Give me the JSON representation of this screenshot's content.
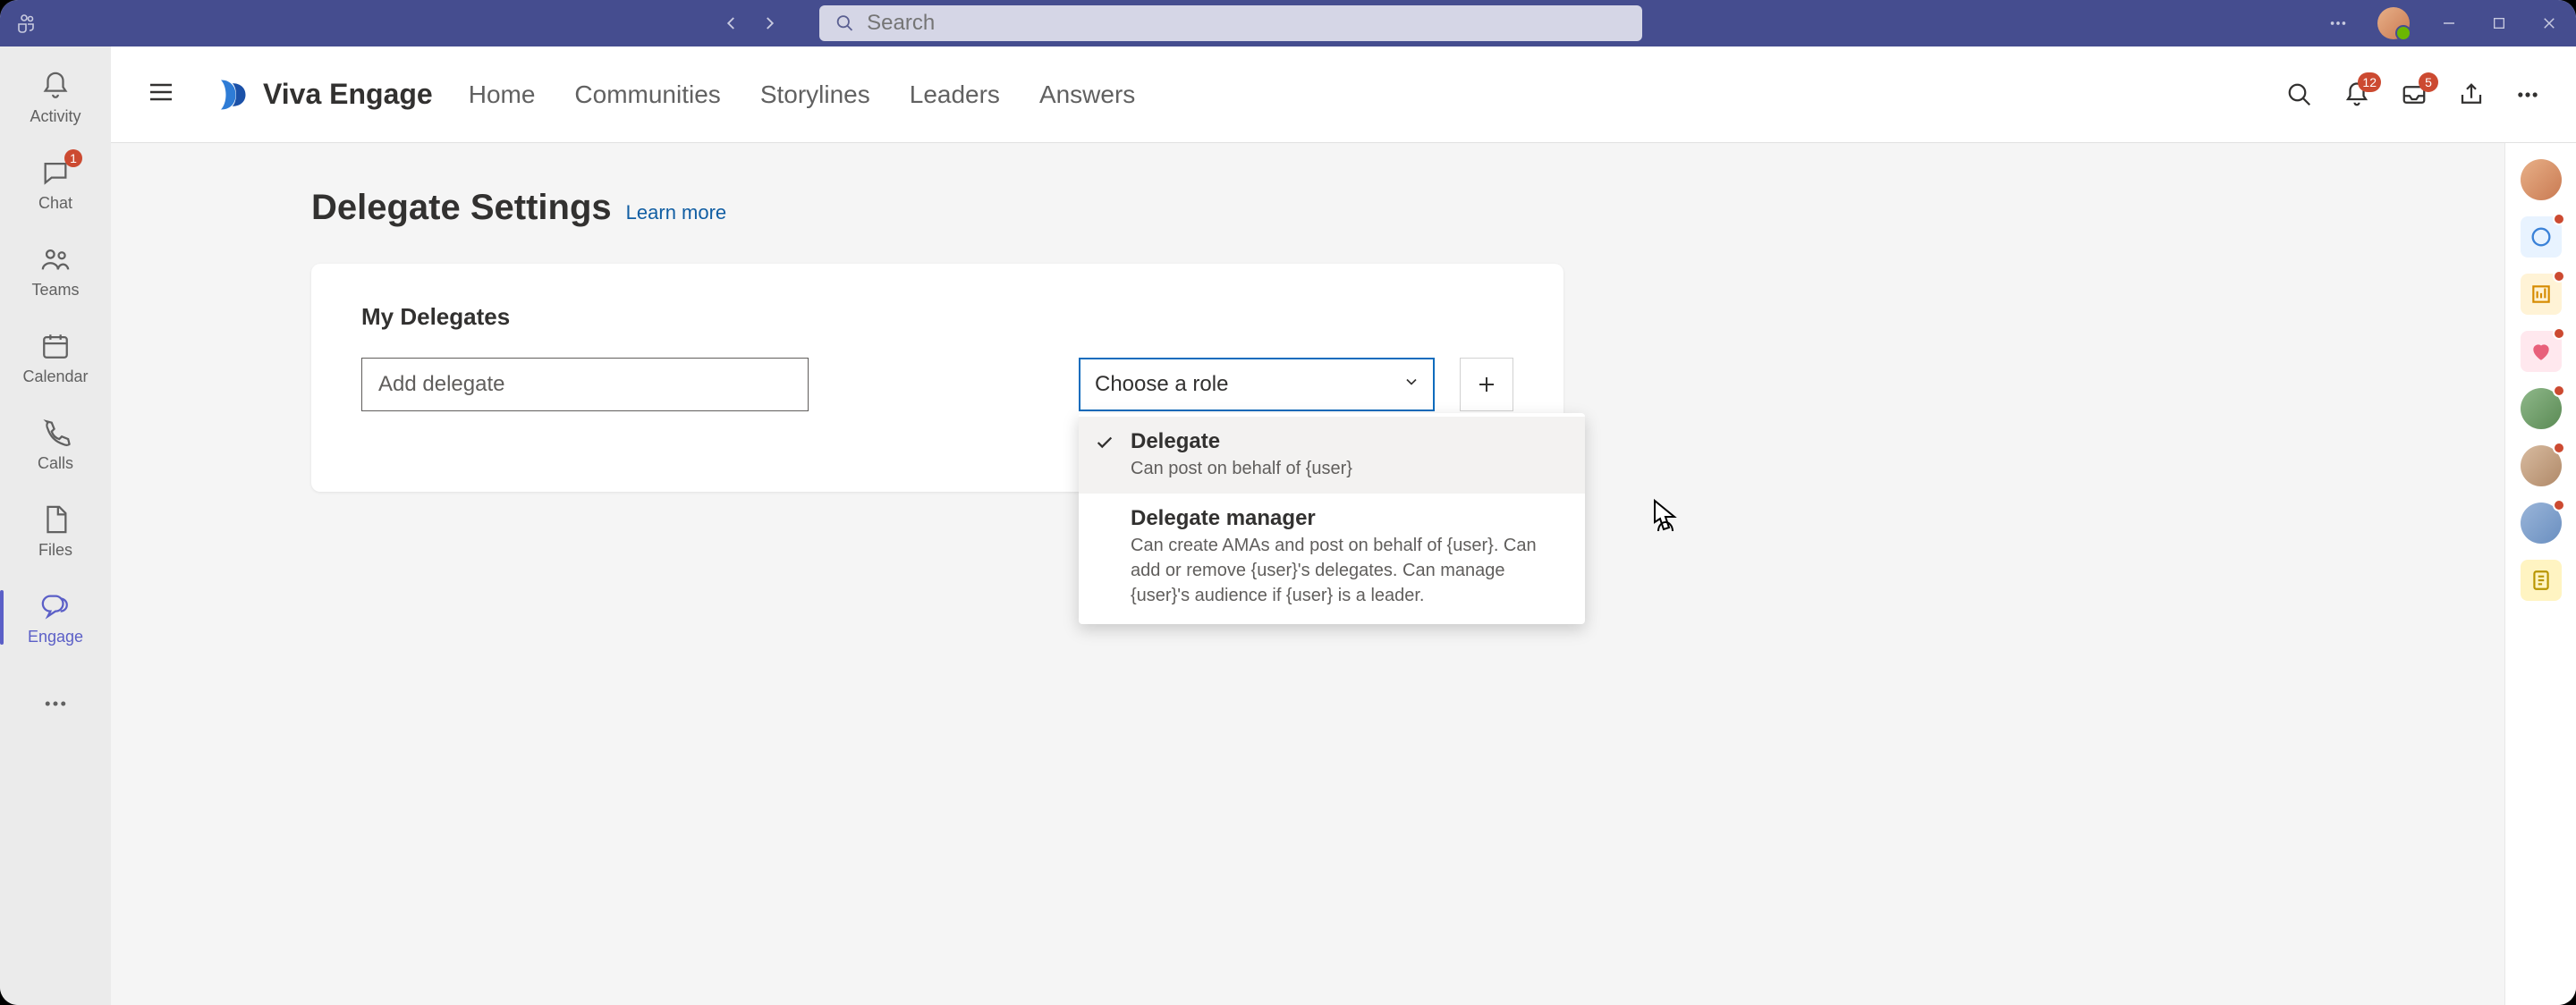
{
  "titlebar": {
    "search_placeholder": "Search"
  },
  "leftrail": {
    "items": [
      {
        "label": "Activity"
      },
      {
        "label": "Chat",
        "badge": "1"
      },
      {
        "label": "Teams"
      },
      {
        "label": "Calendar"
      },
      {
        "label": "Calls"
      },
      {
        "label": "Files"
      },
      {
        "label": "Engage"
      }
    ]
  },
  "appbar": {
    "brand": "Viva Engage",
    "nav": [
      "Home",
      "Communities",
      "Storylines",
      "Leaders",
      "Answers"
    ],
    "notif_badge": "12",
    "inbox_badge": "5"
  },
  "page": {
    "title": "Delegate Settings",
    "learn_more": "Learn more"
  },
  "card": {
    "title": "My Delegates",
    "input_placeholder": "Add delegate",
    "role_placeholder": "Choose a role",
    "options": [
      {
        "title": "Delegate",
        "desc": "Can post on behalf of {user}"
      },
      {
        "title": "Delegate manager",
        "desc": "Can create AMAs and post on behalf of {user}. Can add or remove {user}'s delegates. Can manage {user}'s audience if {user} is a leader."
      }
    ]
  }
}
